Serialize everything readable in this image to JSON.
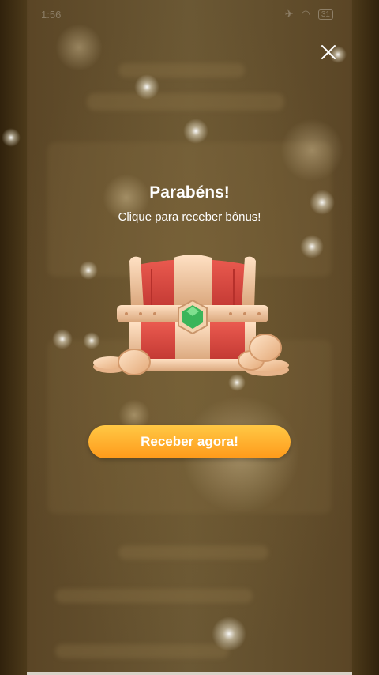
{
  "status_bar": {
    "time": "1:56",
    "battery": "31"
  },
  "modal": {
    "title": "Parabéns!",
    "subtitle": "Clique para receber bônus!",
    "cta_label": "Receber agora!",
    "close_icon": "close-icon",
    "image": "treasure-chest"
  },
  "colors": {
    "cta_top": "#ffc845",
    "cta_bottom": "#ff9a1a",
    "chest_red": "#d8403a",
    "chest_gold": "#f0c9a0",
    "gem_green": "#3bb55a"
  }
}
